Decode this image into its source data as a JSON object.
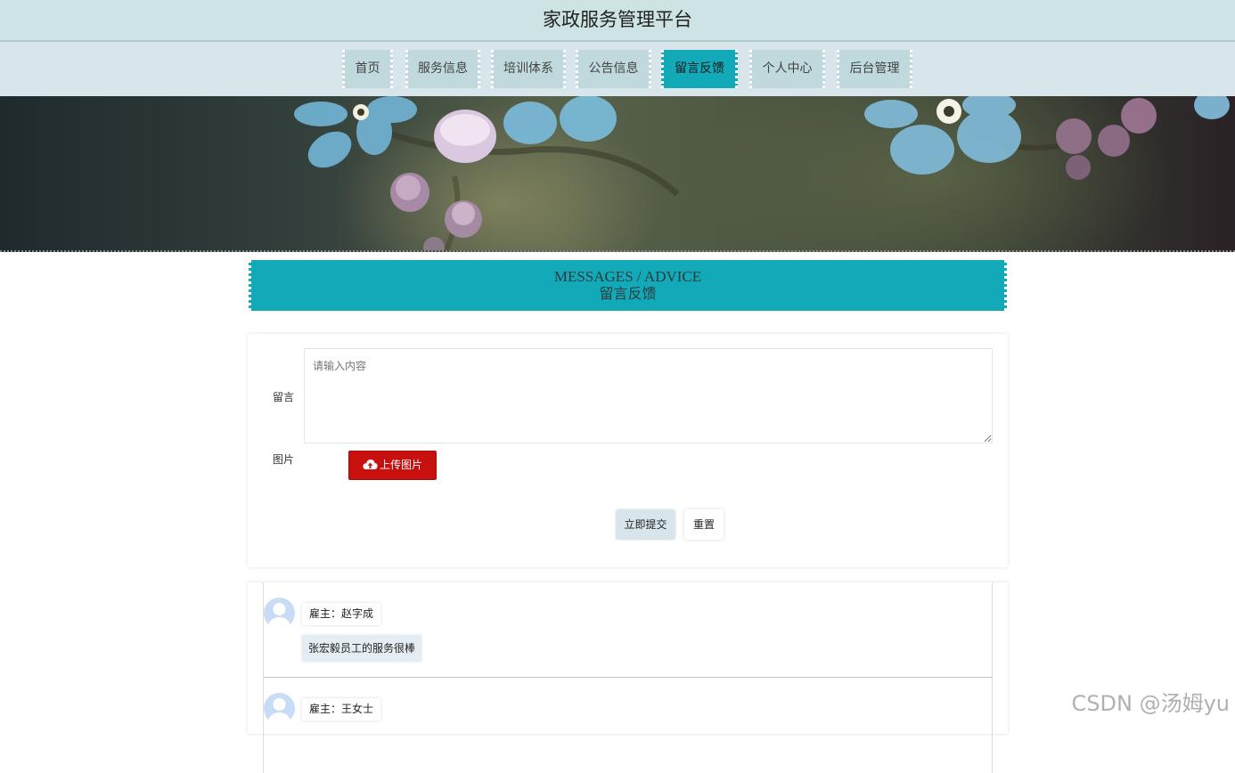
{
  "site": {
    "title": "家政服务管理平台"
  },
  "nav": {
    "items": [
      {
        "label": "首页",
        "active": false
      },
      {
        "label": "服务信息",
        "active": false
      },
      {
        "label": "培训体系",
        "active": false
      },
      {
        "label": "公告信息",
        "active": false
      },
      {
        "label": "留言反馈",
        "active": true
      },
      {
        "label": "个人中心",
        "active": false
      },
      {
        "label": "后台管理",
        "active": false
      }
    ]
  },
  "section": {
    "title_en": "MESSAGES / ADVICE",
    "title_cn": "留言反馈"
  },
  "form": {
    "message_label": "留言",
    "message_placeholder": "请输入内容",
    "image_label": "图片",
    "upload_label": "上传图片",
    "submit_label": "立即提交",
    "reset_label": "重置"
  },
  "comments": [
    {
      "user": "雇主：赵字成",
      "content": "张宏毅员工的服务很棒"
    },
    {
      "user": "雇主：王女士"
    }
  ],
  "watermark": "CSDN @汤姆yu",
  "colors": {
    "accent": "#12aab9",
    "header_bg": "#cde3e4",
    "nav_bg": "#d8e6ec",
    "upload_btn": "#c8100f"
  }
}
